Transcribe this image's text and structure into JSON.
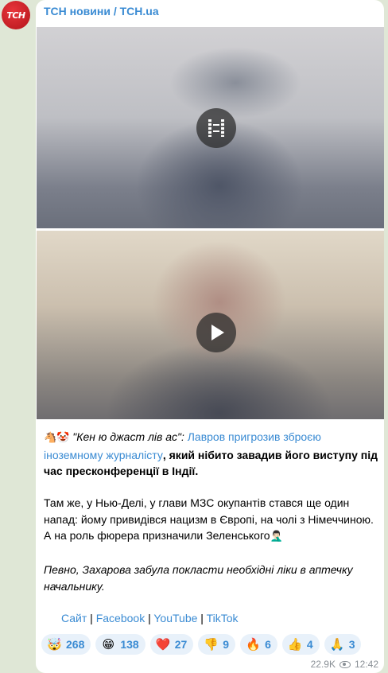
{
  "channel": {
    "avatar_text": "ТСН",
    "name": "ТСН новини / TCH.ua"
  },
  "media": [
    {
      "kind": "video",
      "icon": "film-icon"
    },
    {
      "kind": "video",
      "icon": "play-icon"
    }
  ],
  "post": {
    "emoji_prefix": "🐴🤡",
    "quote": "\"Кен ю джаст лів ас\": ",
    "link_text": "Лавров пригрозив зброєю іноземному журналісту",
    "bold_text": ", який нібито завадив його виступу під час пресконференції в Індії.",
    "paragraph2": "Там же, у Нью-Делі, у глави МЗС окупантів стався ще один напад: йому привидівся нацизм в Європі, на чолі з Німеччиною. А на роль фюрера призначили Зеленського",
    "paragraph2_emoji": "🤦🏻‍♂️",
    "paragraph3": "Певно, Захарова забула покласти необхідні ліки в аптечку начальнику."
  },
  "links": {
    "site": "Сайт",
    "facebook": "Facebook",
    "youtube": "YouTube",
    "tiktok": "TikTok",
    "separator": " | "
  },
  "reactions": [
    {
      "icon": "🤯",
      "count": "268"
    },
    {
      "icon": "😁",
      "count": "138"
    },
    {
      "icon": "❤️",
      "count": "27"
    },
    {
      "icon": "👎",
      "count": "9"
    },
    {
      "icon": "🔥",
      "count": "6"
    },
    {
      "icon": "👍",
      "count": "4"
    },
    {
      "icon": "🙏",
      "count": "3"
    }
  ],
  "meta": {
    "views": "22.9K",
    "time": "12:42"
  },
  "colors": {
    "accent": "#3a8bd3",
    "avatar_red": "#d6262c",
    "background": "#dfe7d6"
  }
}
